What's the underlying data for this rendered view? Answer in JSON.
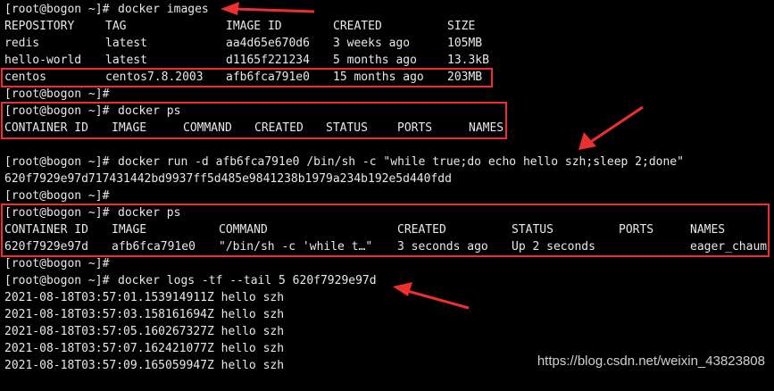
{
  "prompt": "[root@bogon ~]#",
  "commands": {
    "images": "docker images",
    "ps": "docker ps",
    "run": "docker run -d afb6fca791e0 /bin/sh -c \"while true;do echo hello szh;sleep 2;done\"",
    "logs": "docker logs -tf --tail 5 620f7929e97d"
  },
  "images_table": {
    "headers": [
      "REPOSITORY",
      "TAG",
      "IMAGE ID",
      "CREATED",
      "SIZE"
    ],
    "rows": [
      [
        "redis",
        "latest",
        "aa4d65e670d6",
        "3 weeks ago",
        "105MB"
      ],
      [
        "hello-world",
        "latest",
        "d1165f221234",
        "5 months ago",
        "13.3kB"
      ],
      [
        "centos",
        "centos7.8.2003",
        "afb6fca791e0",
        "15 months ago",
        "203MB"
      ]
    ]
  },
  "ps_empty_headers": [
    "CONTAINER ID",
    "IMAGE",
    "COMMAND",
    "CREATED",
    "STATUS",
    "PORTS",
    "NAMES"
  ],
  "run_output": "620f7929e97d717431442bd9937ff5d485e9841238b1979a234b192e5d440fdd",
  "ps_table": {
    "headers": [
      "CONTAINER ID",
      "IMAGE",
      "COMMAND",
      "CREATED",
      "STATUS",
      "PORTS",
      "NAMES"
    ],
    "row": [
      "620f7929e97d",
      "afb6fca791e0",
      "\"/bin/sh -c 'while t…\"",
      "3 seconds ago",
      "Up 2 seconds",
      "",
      "eager_chaum"
    ]
  },
  "logs": [
    "2021-08-18T03:57:01.153914911Z hello szh",
    "2021-08-18T03:57:03.158161694Z hello szh",
    "2021-08-18T03:57:05.160267327Z hello szh",
    "2021-08-18T03:57:07.162421077Z hello szh",
    "2021-08-18T03:57:09.165059947Z hello szh"
  ],
  "watermark": "https://blog.csdn.net/weixin_43823808",
  "colors": {
    "background": "#000000",
    "text": "#e8e8e8",
    "highlight": "#ee2f2f"
  }
}
